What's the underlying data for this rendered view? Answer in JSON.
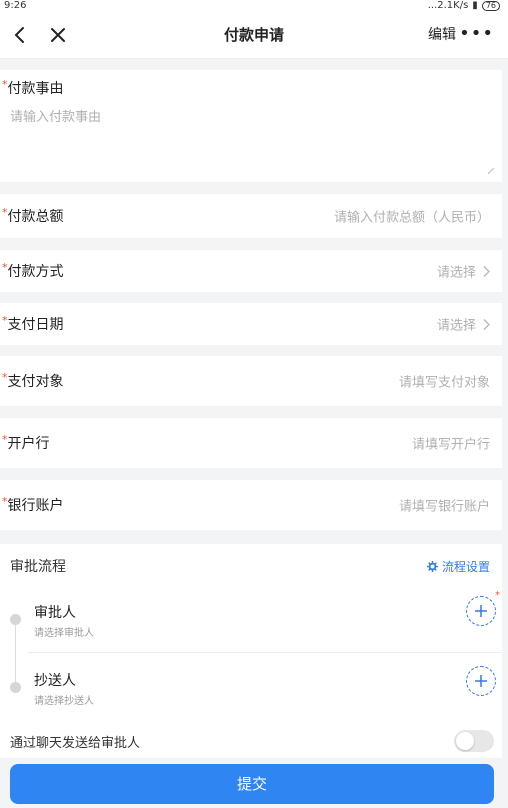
{
  "status": {
    "time": "9:26",
    "speed": "...2.1K/s",
    "battery": "76"
  },
  "nav": {
    "title": "付款申请",
    "edit": "编辑",
    "more": "•••"
  },
  "form": {
    "reason": {
      "label": "付款事由",
      "placeholder": "请输入付款事由"
    },
    "amount": {
      "label": "付款总额",
      "placeholder": "请输入付款总额（人民币）"
    },
    "method": {
      "label": "付款方式",
      "placeholder": "请选择"
    },
    "date": {
      "label": "支付日期",
      "placeholder": "请选择"
    },
    "payee": {
      "label": "支付对象",
      "placeholder": "请填写支付对象"
    },
    "bank": {
      "label": "开户行",
      "placeholder": "请填写开户行"
    },
    "account": {
      "label": "银行账户",
      "placeholder": "请填写银行账户"
    },
    "required_mark": "*"
  },
  "approval": {
    "title": "审批流程",
    "settings": "流程设置",
    "approver": {
      "title": "审批人",
      "sub": "请选择审批人"
    },
    "cc": {
      "title": "抄送人",
      "sub": "请选择抄送人"
    }
  },
  "send_chat": {
    "label": "通过聊天发送给审批人",
    "enabled": false
  },
  "submit": {
    "label": "提交"
  },
  "colors": {
    "accent": "#2f85f1",
    "required": "#e4573d"
  }
}
